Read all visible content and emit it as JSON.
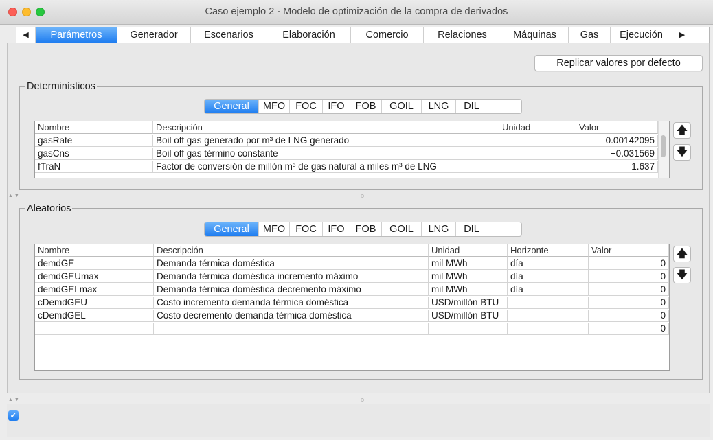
{
  "window": {
    "title": "Caso ejemplo 2 - Modelo de optimización de la compra de derivados"
  },
  "tabs": {
    "prev": "◀",
    "next": "▶",
    "items": [
      "Parámetros",
      "Generador",
      "Escenarios",
      "Elaboración",
      "Comercio",
      "Relaciones",
      "Máquinas",
      "Gas",
      "Ejecución"
    ],
    "active": "Parámetros"
  },
  "reset_button": "Replicar valores por defecto",
  "deterministic": {
    "label": "Determinísticos",
    "subtabs": [
      "General",
      "MFO",
      "FOC",
      "IFO",
      "FOB",
      "GOIL",
      "LNG",
      "DIL"
    ],
    "active_subtab": "General",
    "columns": [
      "Nombre",
      "Descripción",
      "Unidad",
      "Valor"
    ],
    "rows": [
      {
        "nombre": "gasRate",
        "descripcion": "Boil off gas generado por m³ de LNG generado",
        "unidad": "",
        "valor": "0.00142095"
      },
      {
        "nombre": "gasCns",
        "descripcion": "Boil off gas término constante",
        "unidad": "",
        "valor": "−0.031569"
      },
      {
        "nombre": "fTraN",
        "descripcion": "Factor de conversión de millón m³ de gas natural a miles m³ de LNG",
        "unidad": "",
        "valor": "1.637"
      }
    ]
  },
  "random": {
    "label": "Aleatorios",
    "subtabs": [
      "General",
      "MFO",
      "FOC",
      "IFO",
      "FOB",
      "GOIL",
      "LNG",
      "DIL"
    ],
    "active_subtab": "General",
    "columns": [
      "Nombre",
      "Descripción",
      "Unidad",
      "Horizonte",
      "Valor"
    ],
    "rows": [
      {
        "nombre": "demdGE",
        "descripcion": "Demanda térmica doméstica",
        "unidad": "mil MWh",
        "horizonte": "día",
        "valor": "0"
      },
      {
        "nombre": "demdGEUmax",
        "descripcion": "Demanda térmica doméstica incremento máximo",
        "unidad": "mil MWh",
        "horizonte": "día",
        "valor": "0"
      },
      {
        "nombre": "demdGELmax",
        "descripcion": "Demanda térmica doméstica decremento máximo",
        "unidad": "mil MWh",
        "horizonte": "día",
        "valor": "0"
      },
      {
        "nombre": "cDemdGEU",
        "descripcion": "Costo incremento demanda térmica doméstica",
        "unidad": "USD/millón BTU",
        "horizonte": "",
        "valor": "0"
      },
      {
        "nombre": "cDemdGEL",
        "descripcion": "Costo decremento demanda térmica doméstica",
        "unidad": "USD/millón BTU",
        "horizonte": "",
        "valor": "0"
      },
      {
        "nombre": "",
        "descripcion": "",
        "unidad": "",
        "horizonte": "",
        "valor": "0"
      }
    ]
  },
  "icons": {
    "up": "arrow-up-icon",
    "down": "arrow-down-icon",
    "check": "checkmark-icon"
  },
  "colors": {
    "accent": "#1f7df0"
  }
}
